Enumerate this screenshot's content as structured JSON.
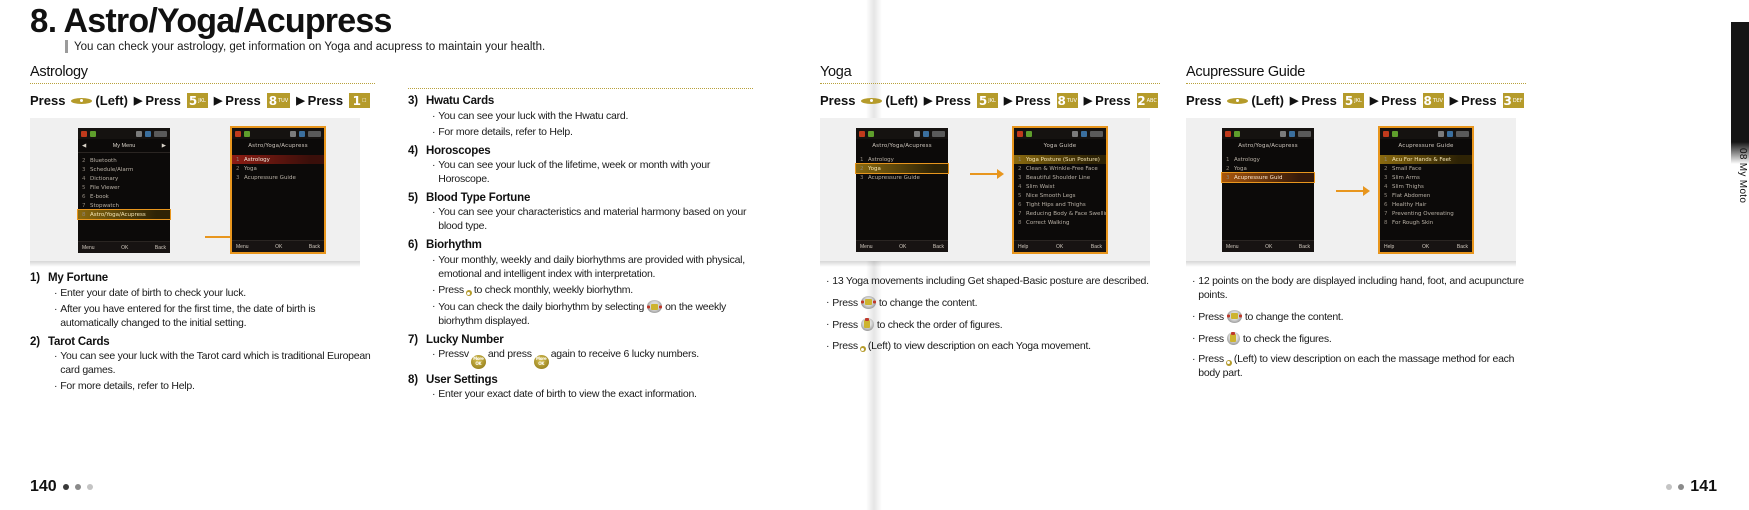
{
  "header": {
    "chapter_number": "8.",
    "chapter_title": "Astro/Yoga/Acupress",
    "subtitle": "You can check your astrology, get information on Yoga and acupress to maintain your health."
  },
  "astrology": {
    "section_title": "Astrology",
    "press_sequence": {
      "press_label": "Press",
      "left_label": "(Left)",
      "arrow": "▶",
      "keys": [
        {
          "glyph": "",
          "sub": "",
          "type": "dot"
        },
        {
          "glyph": "5",
          "sub": "JKL",
          "type": "num"
        },
        {
          "glyph": "8",
          "sub": "TUV",
          "type": "num"
        },
        {
          "glyph": "1",
          "sub": "☐",
          "type": "num"
        }
      ]
    },
    "phone_left": {
      "nav_title": "My Menu",
      "menu": [
        {
          "index": "2",
          "label": "Bluetooth"
        },
        {
          "index": "3",
          "label": "Schedule/Alarm"
        },
        {
          "index": "4",
          "label": "Dictionary"
        },
        {
          "index": "5",
          "label": "File Viewer"
        },
        {
          "index": "6",
          "label": "E-book"
        },
        {
          "index": "7",
          "label": "Stopwatch"
        },
        {
          "index": "8",
          "label": "Astro/Yoga/Acupress",
          "selected": true
        }
      ],
      "soft_left": "Menu",
      "soft_mid": "OK",
      "soft_right": "Back"
    },
    "phone_right": {
      "title": "Astro/Yoga/Acupress",
      "menu": [
        {
          "index": "1",
          "label": "Astrology",
          "selected": true
        },
        {
          "index": "2",
          "label": "Yoga"
        },
        {
          "index": "3",
          "label": "Acupressure Guide"
        }
      ],
      "soft_left": "Menu",
      "soft_mid": "OK",
      "soft_right": "Back"
    },
    "items": [
      {
        "number": "1)",
        "title": "My Fortune",
        "bullets": [
          "Enter your date of birth to check your luck.",
          "After you have entered for the first time, the date of birth is automatically changed to the initial setting."
        ]
      },
      {
        "number": "2)",
        "title": "Tarot Cards",
        "bullets": [
          "You can see your luck with the Tarot card which is traditional European card games.",
          "For more details, refer to Help."
        ]
      },
      {
        "number": "3)",
        "title": "Hwatu Cards",
        "bullets": [
          "You can see your luck with the Hwatu card.",
          "For more details, refer to Help."
        ]
      },
      {
        "number": "4)",
        "title": "Horoscopes",
        "bullets": [
          "You can see your luck of the lifetime, week or month with your Horoscope."
        ]
      },
      {
        "number": "5)",
        "title": "Blood Type Fortune",
        "bullets": [
          "You can see your characteristics and material harmony based on your blood type."
        ]
      },
      {
        "number": "6)",
        "title": "Biorhythm",
        "bullets": [
          "Your monthly, weekly and daily biorhythms are provided with physical, emotional and intelligent index with interpretation."
        ],
        "bullet_key_before": "Press",
        "bullet_key_after": "to check monthly, weekly biorhythm.",
        "bullet_nav_before": "You can check the daily biorhythm by selecting",
        "bullet_nav_after": "on the weekly biorhythm displayed."
      },
      {
        "number": "7)",
        "title": "Lucky Number",
        "bullet_round_before": "Pressv",
        "bullet_round_mid": "and press",
        "bullet_round_after": "again to receive 6 lucky numbers.",
        "round_key_label": "More\nOK"
      },
      {
        "number": "8)",
        "title": "User Settings",
        "bullets": [
          "Enter your exact date of birth to view the exact information."
        ]
      }
    ]
  },
  "yoga": {
    "section_title": "Yoga",
    "press_sequence": {
      "press_label": "Press",
      "left_label": "(Left)",
      "arrow": "▶",
      "keys": [
        {
          "glyph": "",
          "sub": "",
          "type": "dot"
        },
        {
          "glyph": "5",
          "sub": "JKL",
          "type": "num"
        },
        {
          "glyph": "8",
          "sub": "TUV",
          "type": "num"
        },
        {
          "glyph": "2",
          "sub": "ABC",
          "type": "num"
        }
      ]
    },
    "phone_left": {
      "title": "Astro/Yoga/Acupress",
      "menu": [
        {
          "index": "1",
          "label": "Astrology"
        },
        {
          "index": "2",
          "label": "Yoga",
          "selected": true
        },
        {
          "index": "3",
          "label": "Acupressure Guide"
        }
      ],
      "soft_left": "Menu",
      "soft_mid": "OK",
      "soft_right": "Back"
    },
    "phone_right": {
      "title": "Yoga Guide",
      "menu": [
        {
          "index": "1",
          "label": "Yoga Posture (Sun Posture)",
          "selected": true
        },
        {
          "index": "2",
          "label": "Clean & Wrinkle-Free Face"
        },
        {
          "index": "3",
          "label": "Beautiful Shoulder Line"
        },
        {
          "index": "4",
          "label": "Slim Waist"
        },
        {
          "index": "5",
          "label": "Nice Smooth Legs"
        },
        {
          "index": "6",
          "label": "Tight Hips and Thighs"
        },
        {
          "index": "7",
          "label": "Reducing Body & Face Swelling"
        },
        {
          "index": "8",
          "label": "Correct Walking"
        }
      ],
      "soft_left": "Help",
      "soft_mid": "OK",
      "soft_right": "Back"
    },
    "bullets": [
      {
        "text": "13 Yoga movements including Get shaped-Basic posture are described."
      },
      {
        "type": "nav5",
        "before": "Press",
        "after": "to change the content."
      },
      {
        "type": "navup",
        "before": "Press",
        "after": "to check the order of figures."
      },
      {
        "type": "key",
        "before": "Press",
        "after": "(Left) to view description on each Yoga movement."
      }
    ]
  },
  "acupressure": {
    "section_title": "Acupressure Guide",
    "press_sequence": {
      "press_label": "Press",
      "left_label": "(Left)",
      "arrow": "▶",
      "keys": [
        {
          "glyph": "",
          "sub": "",
          "type": "dot"
        },
        {
          "glyph": "5",
          "sub": "JKL",
          "type": "num"
        },
        {
          "glyph": "8",
          "sub": "TUV",
          "type": "num"
        },
        {
          "glyph": "3",
          "sub": "DEF",
          "type": "num"
        }
      ]
    },
    "phone_left": {
      "title": "Astro/Yoga/Acupress",
      "menu": [
        {
          "index": "1",
          "label": "Astrology"
        },
        {
          "index": "2",
          "label": "Yoga"
        },
        {
          "index": "3",
          "label": "Acupressure Guid",
          "selected": true
        }
      ],
      "soft_left": "Menu",
      "soft_mid": "OK",
      "soft_right": "Back"
    },
    "phone_right": {
      "title": "Acupressure Guide",
      "menu": [
        {
          "index": "1",
          "label": "Acu For Hands & Feet",
          "selected": true
        },
        {
          "index": "2",
          "label": "Small Face"
        },
        {
          "index": "3",
          "label": "Slim Arms"
        },
        {
          "index": "4",
          "label": "Slim Thighs"
        },
        {
          "index": "5",
          "label": "Flat Abdomen"
        },
        {
          "index": "6",
          "label": "Healthy Hair"
        },
        {
          "index": "7",
          "label": "Preventing Overeating"
        },
        {
          "index": "8",
          "label": "For Rough Skin"
        }
      ],
      "soft_left": "Help",
      "soft_mid": "OK",
      "soft_right": "Back"
    },
    "bullets": [
      {
        "text": "12 points on the body are displayed including hand, foot, and acupuncture points."
      },
      {
        "type": "nav5",
        "before": "Press",
        "after": "to change the content."
      },
      {
        "type": "navup",
        "before": "Press",
        "after": "to check the figures."
      },
      {
        "type": "key",
        "before": "Press",
        "after": "(Left) to view description on each the massage method for each body part."
      }
    ]
  },
  "footer": {
    "left_page": "140",
    "right_page": "141",
    "side_tab": "08  My Moto"
  },
  "colors": {
    "key_gold": "#b59b2b",
    "frame_orange": "#e8961e",
    "rule_gold": "#b9a23d",
    "text": "#1a1a1a"
  }
}
